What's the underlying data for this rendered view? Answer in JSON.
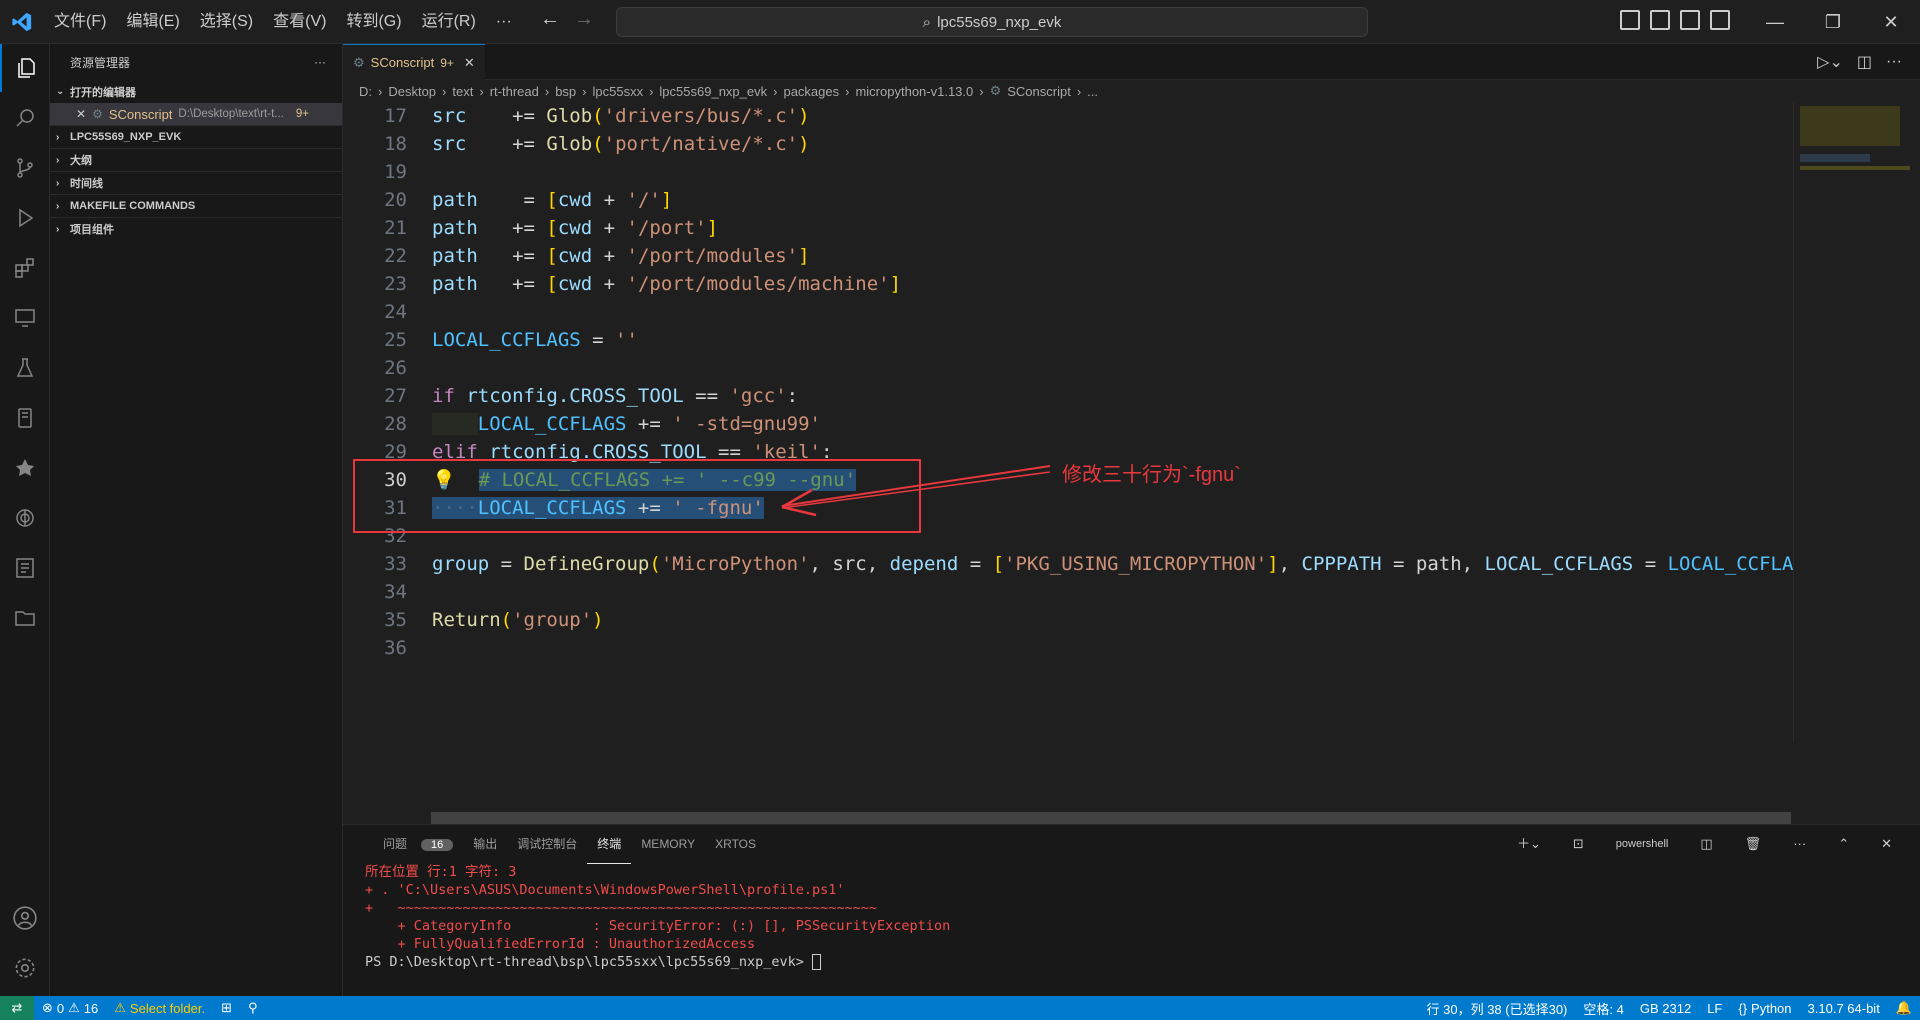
{
  "titlebar": {
    "menu": [
      "文件(F)",
      "编辑(E)",
      "选择(S)",
      "查看(V)",
      "转到(G)",
      "运行(R)",
      "···"
    ],
    "search": "lpc55s69_nxp_evk"
  },
  "sidebar": {
    "title": "资源管理器",
    "open_editors": "打开的编辑器",
    "open_file": "SConscript",
    "open_file_path": "D:\\Desktop\\text\\rt-t...",
    "open_file_badge": "9+",
    "sections": [
      "LPC55S69_NXP_EVK",
      "大纲",
      "时间线",
      "MAKEFILE COMMANDS",
      "项目组件"
    ]
  },
  "tab": {
    "label": "SConscript",
    "badge": "9+"
  },
  "breadcrumb": [
    "D:",
    "Desktop",
    "text",
    "rt-thread",
    "bsp",
    "lpc55sxx",
    "lpc55s69_nxp_evk",
    "packages",
    "micropython-v1.13.0",
    "SConscript",
    "..."
  ],
  "code": {
    "line_numbers": [
      "17",
      "18",
      "19",
      "20",
      "21",
      "22",
      "23",
      "24",
      "25",
      "26",
      "27",
      "28",
      "29",
      "30",
      "31",
      "32",
      "33",
      "34",
      "35",
      "36"
    ],
    "l17a": "src",
    "l17b": "    += ",
    "l17c": "Glob",
    "l17d": "'drivers/bus/*.c'",
    "l18a": "src",
    "l18b": "    += ",
    "l18c": "Glob",
    "l18d": "'port/native/*.c'",
    "l20a": "path",
    "l20b": "    = ",
    "l20c": "cwd",
    "l20d": " + ",
    "l20e": "'/'",
    "l21a": "path",
    "l21b": "   += ",
    "l21c": "cwd",
    "l21d": " + ",
    "l21e": "'/port'",
    "l22a": "path",
    "l22b": "   += ",
    "l22c": "cwd",
    "l22d": " + ",
    "l22e": "'/port/modules'",
    "l23a": "path",
    "l23b": "   += ",
    "l23c": "cwd",
    "l23d": " + ",
    "l23e": "'/port/modules/machine'",
    "l25a": "LOCAL_CCFLAGS",
    "l25b": " = ",
    "l25c": "''",
    "l27a": "if",
    "l27b": " rtconfig",
    "l27c": ".CROSS_TOOL",
    "l27d": " == ",
    "l27e": "'gcc'",
    "l27f": ":",
    "l28a": "LOCAL_CCFLAGS",
    "l28b": " += ",
    "l28c": "' -std=gnu99'",
    "l29a": "elif",
    "l29b": " rtconfig",
    "l29c": ".CROSS_TOOL",
    "l29d": " == ",
    "l29e": "'keil'",
    "l29f": ":",
    "l30": "# LOCAL_CCFLAGS += ' --c99 --gnu'",
    "l31a": "LOCAL_CCFLAGS",
    "l31b": " += ",
    "l31c": "' -fgnu'",
    "l33a": "group",
    "l33b": " = ",
    "l33c": "DefineGroup",
    "l33d": "'MicroPython'",
    "l33e": ", src, ",
    "l33f": "depend",
    "l33g": " = ",
    "l33h": "'PKG_USING_MICROPYTHON'",
    "l33i": ", ",
    "l33j": "CPPPATH",
    "l33k": " = path, ",
    "l33l": "LOCAL_CCFLAGS",
    "l33m": " = ",
    "l33n": "LOCAL_CCFLA",
    "l35a": "Return",
    "l35b": "'group'"
  },
  "annotation": "修改三十行为`-fgnu`",
  "panel": {
    "tabs": [
      "问题",
      "输出",
      "调试控制台",
      "终端",
      "MEMORY",
      "XRTOS"
    ],
    "problems_count": "16",
    "shell": "powershell",
    "terminal_lines": [
      "所在位置 行:1 字符: 3",
      "+ . 'C:\\Users\\ASUS\\Documents\\WindowsPowerShell\\profile.ps1'",
      "+   ~~~~~~~~~~~~~~~~~~~~~~~~~~~~~~~~~~~~~~~~~~~~~~~~~~~~~~~~~~~",
      "    + CategoryInfo          : SecurityError: (:) [], PSSecurityException",
      "    + FullyQualifiedErrorId : UnauthorizedAccess"
    ],
    "prompt": "PS D:\\Desktop\\rt-thread\\bsp\\lpc55sxx\\lpc55s69_nxp_evk> "
  },
  "status": {
    "errors": "0",
    "warnings": "16",
    "select_folder": "Select folder.",
    "position": "行 30，列 38 (已选择30)",
    "spaces": "空格: 4",
    "encoding": "GB 2312",
    "eol": "LF",
    "language": "Python",
    "interpreter": "3.10.7 64-bit"
  },
  "colors": {
    "accent": "#007acc",
    "annotation": "#e8383d"
  }
}
